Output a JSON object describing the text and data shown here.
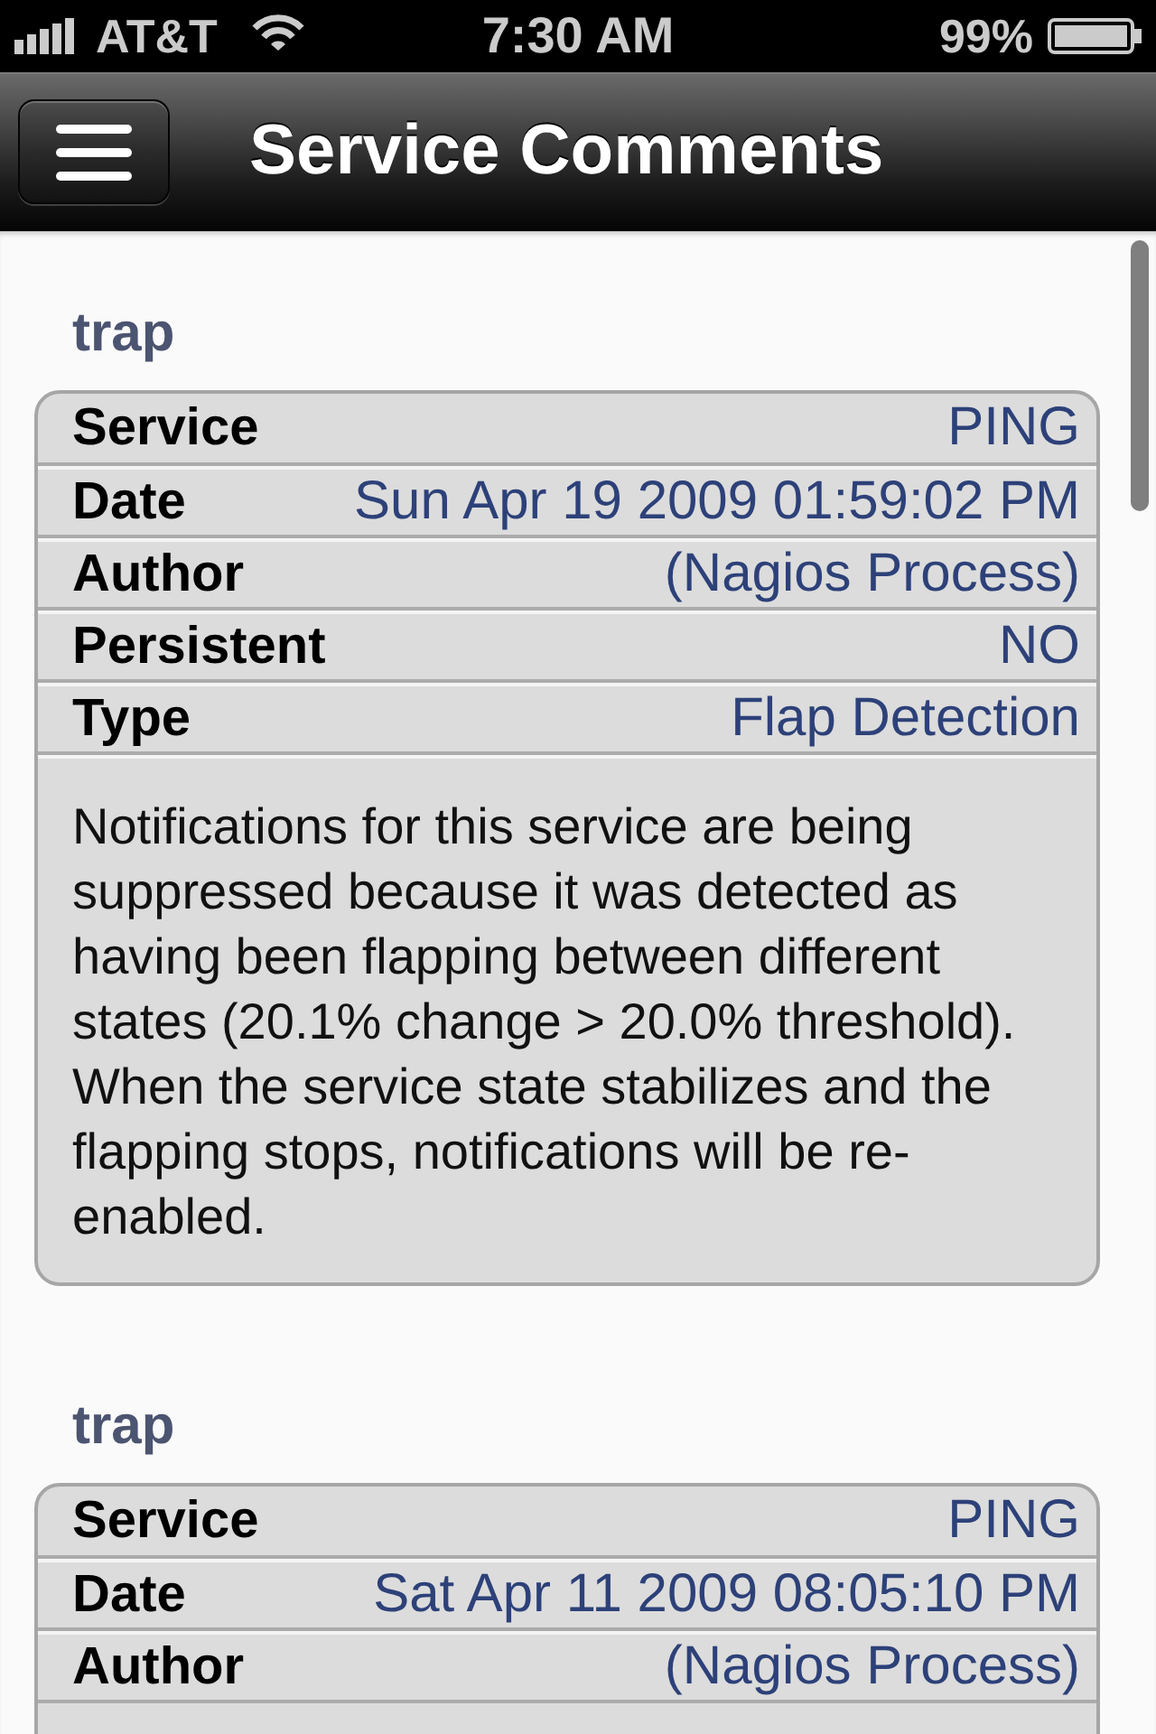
{
  "status_bar": {
    "carrier": "AT&T",
    "time": "7:30 AM",
    "battery": "99%"
  },
  "nav_bar": {
    "title": "Service Comments"
  },
  "comments": [
    {
      "title": "trap",
      "fields": [
        {
          "label": "Service",
          "value": "PING"
        },
        {
          "label": "Date",
          "value": "Sun Apr 19 2009 01:59:02 PM"
        },
        {
          "label": "Author",
          "value": "(Nagios Process)"
        },
        {
          "label": "Persistent",
          "value": "NO"
        },
        {
          "label": "Type",
          "value": "Flap Detection"
        }
      ],
      "text": "Notifications for this service are being suppressed because it was detected as having been flapping between different states (20.1% change > 20.0% threshold). When the service state stabilizes and the flapping stops, notifications will be re-enabled."
    },
    {
      "title": "trap",
      "fields": [
        {
          "label": "Service",
          "value": "PING"
        },
        {
          "label": "Date",
          "value": "Sat Apr 11 2009 08:05:10 PM"
        },
        {
          "label": "Author",
          "value": "(Nagios Process)"
        }
      ]
    }
  ]
}
